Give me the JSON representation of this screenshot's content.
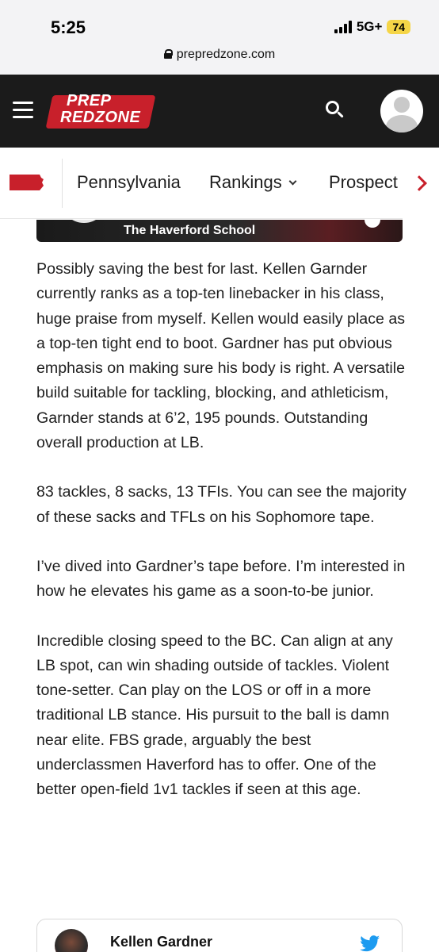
{
  "status_bar": {
    "time": "5:25",
    "network": "5G+",
    "battery": "74",
    "url": "prepredzone.com"
  },
  "header": {
    "logo_top": "PREP",
    "logo_bottom": "REDZONE",
    "brand_color": "#c8202b",
    "background_color": "#1b1b1b"
  },
  "nav": {
    "items": [
      {
        "label": "Pennsylvania"
      },
      {
        "label": "Rankings"
      },
      {
        "label": "Prospect"
      }
    ]
  },
  "banner": {
    "school": "The Haverford School"
  },
  "article": {
    "paragraphs": [
      "Possibly saving the best for last. Kellen Garnder currently ranks as a top-ten linebacker in his class, huge praise from myself. Kellen would easily place as a top-ten tight end to boot. Gardner has put obvious emphasis on making sure his body is right. A versatile build suitable for tackling, blocking, and athleticism, Garnder stands at 6’2, 195 pounds. Outstanding overall production at LB.",
      "83 tackles, 8 sacks, 13 TFIs. You can see the majority of these sacks and TFLs on his Sophomore tape.",
      "I’ve dived into Gardner’s tape before. I’m interested in how he elevates his game as a soon-to-be junior.",
      "Incredible closing speed to the BC. Can align at any LB spot, can win shading outside of tackles. Violent tone-setter. Can play on the LOS or off in a more traditional LB stance. His pursuit to the ball is damn near elite. FBS grade, arguably the best underclassmen Haverford has to offer. One of the better open-field 1v1 tackles if seen at this age."
    ]
  },
  "tweet": {
    "name": "Kellen Gardner",
    "icon": "twitter-bird-icon",
    "accent": "#1d9bf0"
  }
}
